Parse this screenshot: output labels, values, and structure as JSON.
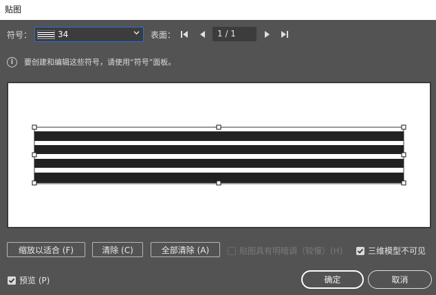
{
  "window": {
    "title": "贴图"
  },
  "symbol": {
    "label": "符号：",
    "value": "34"
  },
  "surface": {
    "label": "表面：",
    "page": "1 / 1"
  },
  "info": {
    "text": "要创建和编辑这些符号，请使用“符号”面板。"
  },
  "buttons": {
    "fit": "缩放以适合 (F)",
    "clear": "清除 (C)",
    "clear_all": "全部清除 (A)",
    "ok": "确定",
    "cancel": "取消"
  },
  "checkboxes": {
    "shade": {
      "label": "贴图具有明暗调（较慢）(H)",
      "checked": false,
      "enabled": false
    },
    "invisible": {
      "label": "三维模型不可见",
      "checked": true,
      "enabled": true
    },
    "preview": {
      "label": "预览 (P)",
      "checked": true,
      "enabled": true
    }
  },
  "colors": {
    "dialog_bg": "#535353",
    "accent": "#2a6edc",
    "stripe": "#222222"
  },
  "icons": {
    "info": "info-icon",
    "first": "first-page-icon",
    "prev": "prev-page-icon",
    "next": "next-page-icon",
    "last": "last-page-icon",
    "dropdown": "chevron-down-icon",
    "check": "check-icon"
  }
}
